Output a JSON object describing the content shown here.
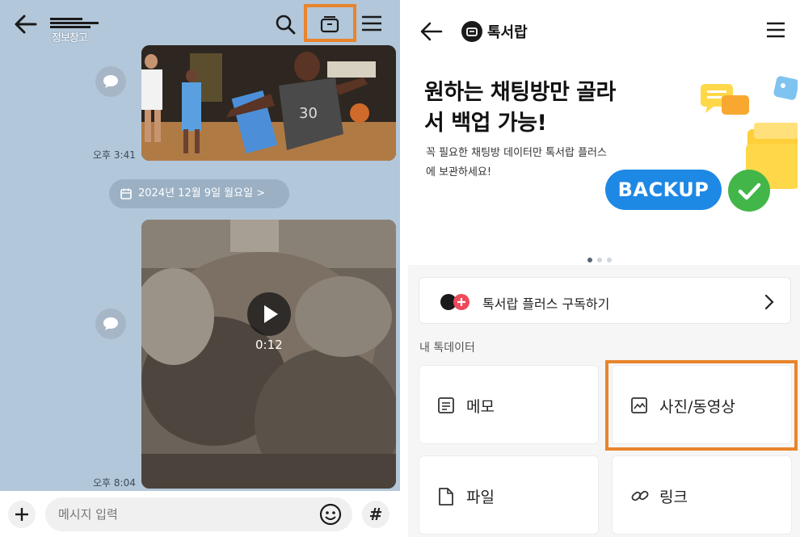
{
  "chat": {
    "title_text": "정보창고",
    "drawer_tag": "톡서랍",
    "message_1_time": "오후 3:41",
    "date_divider": "2024년 12월 9일 월요일 >",
    "video_duration": "0:12",
    "message_2_time": "오후 8:04",
    "input_placeholder": "메시지 입력",
    "hash_label": "#"
  },
  "drawer": {
    "title": "톡서랍",
    "banner": {
      "headline": "원하는 채팅방만 골라서 백업 가능!",
      "subtext": "꼭 필요한 채팅방 데이터만 톡서랍 플러스에 보관하세요!",
      "badge": "BACKUP",
      "pages": 3,
      "current_page": 1
    },
    "plus_subscribe_label": "톡서랍 플러스 구독하기",
    "section_title": "내 톡데이터",
    "tiles": [
      {
        "label": "메모",
        "icon": "memo-icon"
      },
      {
        "label": "사진/동영상",
        "icon": "photo-icon"
      },
      {
        "label": "파일",
        "icon": "file-icon"
      },
      {
        "label": "링크",
        "icon": "link-icon"
      }
    ]
  },
  "colors": {
    "chat_bg": "#b2c7da",
    "highlight_orange": "#e8842c",
    "tag_yellow": "#fff200",
    "backup_blue": "#1e88e5",
    "check_green": "#43b649"
  }
}
